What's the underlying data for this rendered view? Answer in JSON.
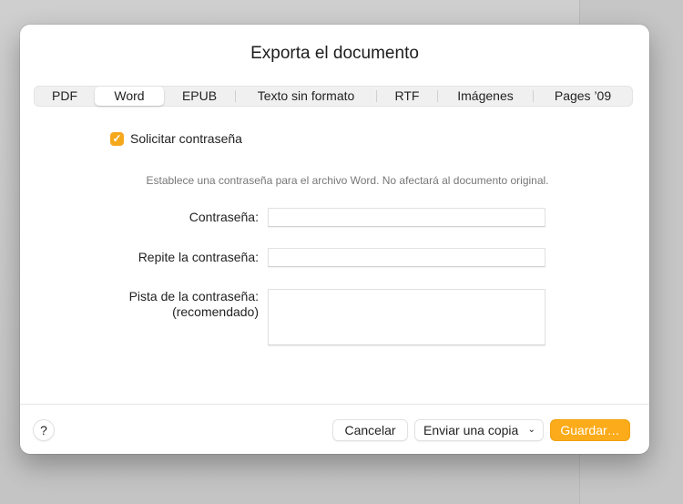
{
  "dialog": {
    "title": "Exporta el documento"
  },
  "tabs": [
    {
      "label": "PDF"
    },
    {
      "label": "Word"
    },
    {
      "label": "EPUB"
    },
    {
      "label": "Texto sin formato"
    },
    {
      "label": "RTF"
    },
    {
      "label": "Imágenes"
    },
    {
      "label": "Pages ’09"
    }
  ],
  "selected_tab": "Word",
  "password": {
    "checkbox_label": "Solicitar contraseña",
    "checked": true,
    "hint": "Establece una contraseña para el archivo Word. No afectará al documento original.",
    "password_label": "Contraseña:",
    "password_value": "",
    "repeat_label": "Repite la contraseña:",
    "repeat_value": "",
    "hint_label_line1": "Pista de la contraseña:",
    "hint_label_line2": "(recomendado)",
    "hint_value": ""
  },
  "footer": {
    "help": "?",
    "cancel": "Cancelar",
    "send_copy": "Enviar una copia",
    "save": "Guardar…"
  },
  "colors": {
    "accent": "#fcab1a"
  }
}
